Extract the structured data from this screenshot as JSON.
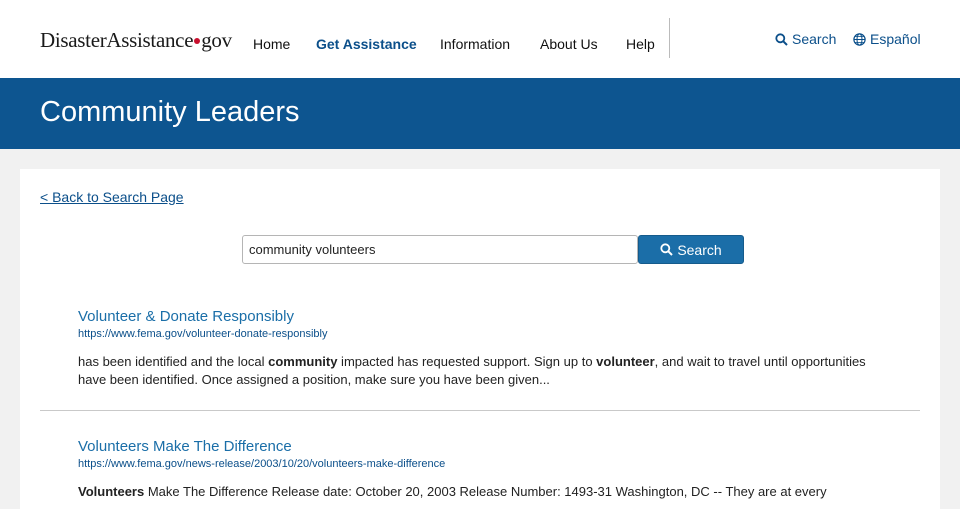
{
  "header": {
    "logo_text_a": "DisasterAssistance",
    "logo_text_b": "gov",
    "nav": [
      {
        "label": "Home"
      },
      {
        "label": "Get Assistance"
      },
      {
        "label": "Information"
      },
      {
        "label": "About Us"
      },
      {
        "label": "Help"
      }
    ],
    "search_label": "Search",
    "language_label": "Español"
  },
  "banner": {
    "title": "Community Leaders"
  },
  "main": {
    "back_link": "< Back to Search Page",
    "search": {
      "value": "community volunteers",
      "button_label": "Search"
    },
    "results": [
      {
        "title": "Volunteer & Donate Responsibly",
        "url": "https://www.fema.gov/volunteer-donate-responsibly",
        "snippet": [
          {
            "t": "has been identified and the local ",
            "b": false
          },
          {
            "t": "community",
            "b": true
          },
          {
            "t": " impacted has requested support. Sign up to ",
            "b": false
          },
          {
            "t": "volunteer",
            "b": true
          },
          {
            "t": ", and wait to travel until opportunities have been identified. Once assigned a position, make sure you have been given...",
            "b": false
          }
        ]
      },
      {
        "title": "Volunteers Make The Difference",
        "url": "https://www.fema.gov/news-release/2003/10/20/volunteers-make-difference",
        "snippet": [
          {
            "t": "Volunteers",
            "b": true
          },
          {
            "t": " Make The Difference Release date:  October 20, 2003 Release Number:  1493-31 Washington, DC -- They are at every",
            "b": false
          }
        ]
      }
    ]
  },
  "colors": {
    "brand_blue": "#0d5590",
    "link_blue": "#1a6ea8",
    "logo_dot": "#c8102e"
  },
  "icons": {
    "search": "magnifier-icon",
    "language": "globe-icon"
  }
}
